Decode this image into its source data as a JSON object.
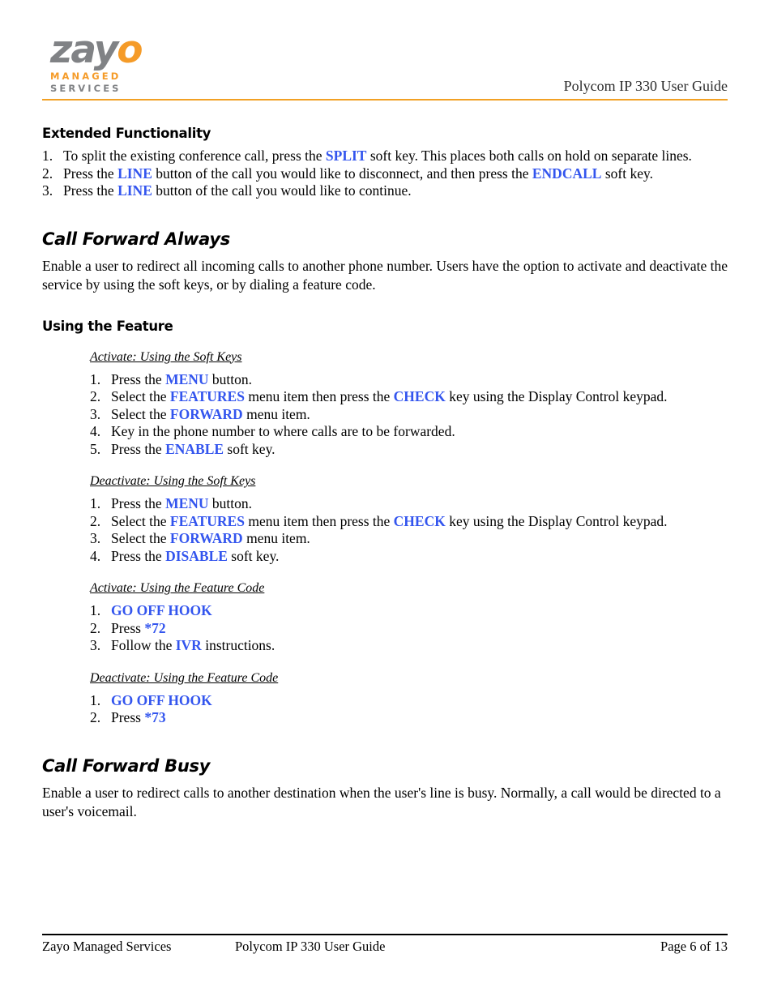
{
  "header": {
    "logo": {
      "word_gray": "zay",
      "word_orange": "o",
      "sub_line1": "MANAGED",
      "sub_line2": "SERVICES",
      "gray_hex": "#808285",
      "orange_hex": "#F59B28"
    },
    "title": "Polycom IP 330 User Guide",
    "rule_color": "#F2A024"
  },
  "colors": {
    "keyword_blue": "#3355EE",
    "text_black": "#000000"
  },
  "content": {
    "extended_functionality": {
      "heading": "Extended Functionality",
      "steps": [
        {
          "num": "1.",
          "parts": [
            {
              "t": "To split the existing conference call, press the ",
              "k": false
            },
            {
              "t": "SPLIT",
              "k": true
            },
            {
              "t": " soft key.  This places both calls on hold on separate lines.",
              "k": false
            }
          ]
        },
        {
          "num": "2.",
          "parts": [
            {
              "t": "Press the ",
              "k": false
            },
            {
              "t": "LINE",
              "k": true
            },
            {
              "t": " button of the call you would like to disconnect, and then press the ",
              "k": false
            },
            {
              "t": "ENDCALL",
              "k": true
            },
            {
              "t": " soft key.",
              "k": false
            }
          ]
        },
        {
          "num": "3.",
          "parts": [
            {
              "t": "Press the ",
              "k": false
            },
            {
              "t": "LINE",
              "k": true
            },
            {
              "t": " button of the call you would like to continue.",
              "k": false
            }
          ]
        }
      ]
    },
    "call_forward_always": {
      "heading": "Call Forward Always",
      "intro": "Enable a user to redirect all incoming calls to another phone number. Users have the option to activate and deactivate the service by using the soft keys, or by dialing a feature code.",
      "using_feature_heading": "Using the Feature",
      "blocks": [
        {
          "minor_heading": "Activate: Using the Soft Keys",
          "steps": [
            {
              "num": "1.",
              "parts": [
                {
                  "t": "Press the ",
                  "k": false
                },
                {
                  "t": "MENU",
                  "k": true
                },
                {
                  "t": " button.",
                  "k": false
                }
              ]
            },
            {
              "num": "2.",
              "parts": [
                {
                  "t": "Select the ",
                  "k": false
                },
                {
                  "t": "FEATURES",
                  "k": true
                },
                {
                  "t": " menu item then press the ",
                  "k": false
                },
                {
                  "t": "CHECK",
                  "k": true
                },
                {
                  "t": " key using the Display Control keypad.",
                  "k": false
                }
              ]
            },
            {
              "num": "3.",
              "parts": [
                {
                  "t": "Select the ",
                  "k": false
                },
                {
                  "t": "FORWARD",
                  "k": true
                },
                {
                  "t": " menu item.",
                  "k": false
                }
              ]
            },
            {
              "num": "4.",
              "parts": [
                {
                  "t": "Key in the phone number to where calls are to be forwarded.",
                  "k": false
                }
              ]
            },
            {
              "num": "5.",
              "parts": [
                {
                  "t": "Press the ",
                  "k": false
                },
                {
                  "t": "ENABLE",
                  "k": true
                },
                {
                  "t": " soft key.",
                  "k": false
                }
              ]
            }
          ]
        },
        {
          "minor_heading": "Deactivate: Using the Soft Keys",
          "steps": [
            {
              "num": "1.",
              "parts": [
                {
                  "t": "Press the ",
                  "k": false
                },
                {
                  "t": "MENU",
                  "k": true
                },
                {
                  "t": " button.",
                  "k": false
                }
              ]
            },
            {
              "num": "2.",
              "parts": [
                {
                  "t": "Select the ",
                  "k": false
                },
                {
                  "t": "FEATURES",
                  "k": true
                },
                {
                  "t": " menu item then press the ",
                  "k": false
                },
                {
                  "t": "CHECK",
                  "k": true
                },
                {
                  "t": " key using the Display Control keypad.",
                  "k": false
                }
              ]
            },
            {
              "num": "3.",
              "parts": [
                {
                  "t": "Select the ",
                  "k": false
                },
                {
                  "t": "FORWARD",
                  "k": true
                },
                {
                  "t": " menu item.",
                  "k": false
                }
              ]
            },
            {
              "num": "4.",
              "parts": [
                {
                  "t": "Press the ",
                  "k": false
                },
                {
                  "t": "DISABLE",
                  "k": true
                },
                {
                  "t": " soft key.",
                  "k": false
                }
              ]
            }
          ]
        },
        {
          "minor_heading": "Activate: Using the Feature Code",
          "steps": [
            {
              "num": "1.",
              "parts": [
                {
                  "t": "GO OFF HOOK",
                  "k": true
                }
              ]
            },
            {
              "num": "2.",
              "parts": [
                {
                  "t": "Press ",
                  "k": false
                },
                {
                  "t": "*72",
                  "k": true
                }
              ]
            },
            {
              "num": "3.",
              "parts": [
                {
                  "t": "Follow the ",
                  "k": false
                },
                {
                  "t": "IVR",
                  "k": true
                },
                {
                  "t": " instructions.",
                  "k": false
                }
              ]
            }
          ]
        },
        {
          "minor_heading": "Deactivate: Using the Feature Code",
          "steps": [
            {
              "num": "1.",
              "parts": [
                {
                  "t": "GO OFF HOOK",
                  "k": true
                }
              ]
            },
            {
              "num": "2.",
              "parts": [
                {
                  "t": "Press ",
                  "k": false
                },
                {
                  "t": "*73",
                  "k": true
                }
              ]
            }
          ]
        }
      ]
    },
    "call_forward_busy": {
      "heading": "Call Forward Busy",
      "intro": "Enable a user to redirect calls to another destination when the user's line is busy.  Normally, a call would be directed to a user's voicemail."
    }
  },
  "footer": {
    "left": "Zayo Managed Services",
    "center": "Polycom IP 330 User Guide",
    "right": "Page 6 of 13"
  }
}
